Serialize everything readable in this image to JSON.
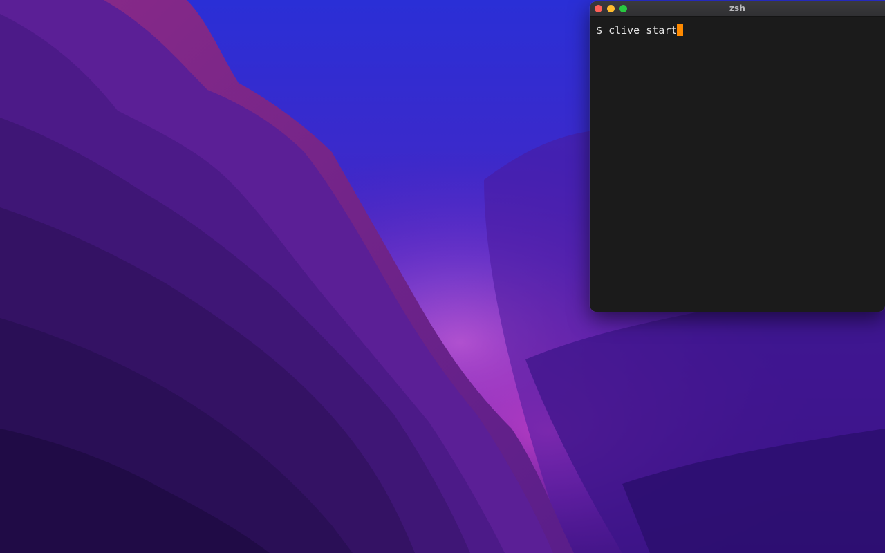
{
  "terminal": {
    "title": "zsh",
    "prompt": "$",
    "command": "clive start"
  },
  "colors": {
    "cursor": "#ff8a00",
    "terminal_background": "#1b1b1b",
    "close": "#fe5f57",
    "minimize": "#febc2e",
    "zoom": "#28c840"
  },
  "icons": {
    "close": "close-traffic-light",
    "minimize": "minimize-traffic-light",
    "zoom": "zoom-traffic-light"
  }
}
